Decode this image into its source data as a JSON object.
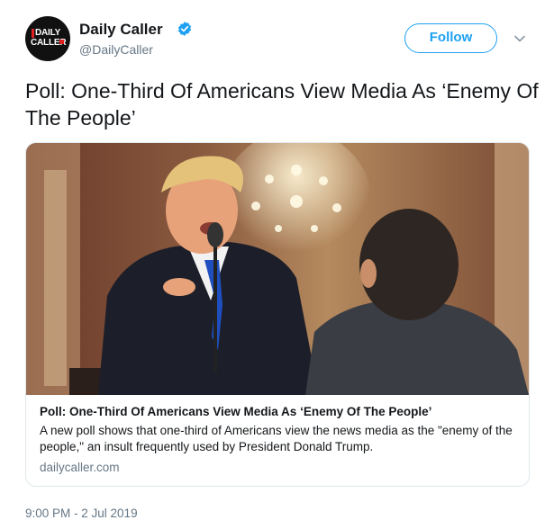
{
  "account": {
    "name": "Daily Caller",
    "handle": "@DailyCaller",
    "avatar_text_line1": "DAILY",
    "avatar_text_line2": "CALLER",
    "verified_icon": "verified-badge-icon",
    "verified_color": "#1da1f2"
  },
  "actions": {
    "follow_label": "Follow",
    "more_icon": "chevron-down-icon"
  },
  "tweet": {
    "text": "Poll: One-Third Of Americans View Media As ‘Enemy Of The People’",
    "timestamp": "9:00 PM - 2 Jul 2019"
  },
  "card": {
    "title": "Poll: One-Third Of Americans View Media As ‘Enemy Of The People’",
    "description": "A new poll shows that one-third of Americans view the news media as the \"enemy of the people,\" an insult frequently used by President Donald Trump.",
    "domain": "dailycaller.com"
  },
  "colors": {
    "accent": "#1da1f2",
    "secondary_text": "#657786",
    "border": "#e1e8ed"
  }
}
